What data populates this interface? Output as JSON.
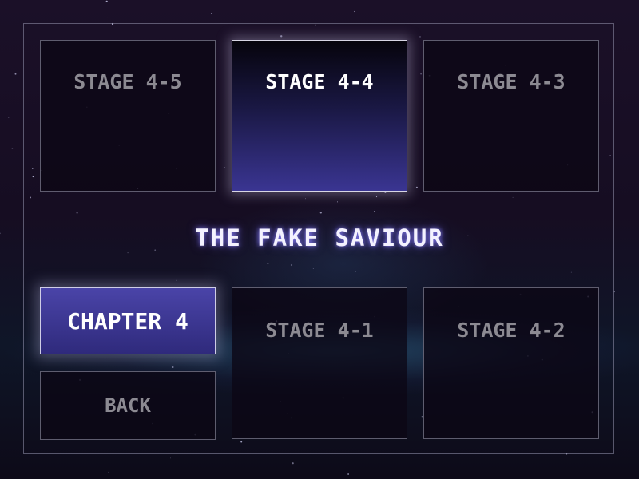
{
  "screen": {
    "chapter_title": "THE FAKE SAVIOUR"
  },
  "stages_top": [
    {
      "label": "STAGE 4-5",
      "selected": false
    },
    {
      "label": "STAGE 4-4",
      "selected": true
    },
    {
      "label": "STAGE 4-3",
      "selected": false
    }
  ],
  "stages_bottom": [
    {
      "label": "STAGE 4-1",
      "selected": false
    },
    {
      "label": "STAGE 4-2",
      "selected": false
    }
  ],
  "chapter_button": {
    "label": "CHAPTER 4"
  },
  "back_button": {
    "label": "BACK"
  },
  "colors": {
    "selected_tile_glow": "#3a3592",
    "chapter_button": "#4a44a8",
    "title_glow": "#8c82ff",
    "inactive_text": "#8c8a92"
  }
}
